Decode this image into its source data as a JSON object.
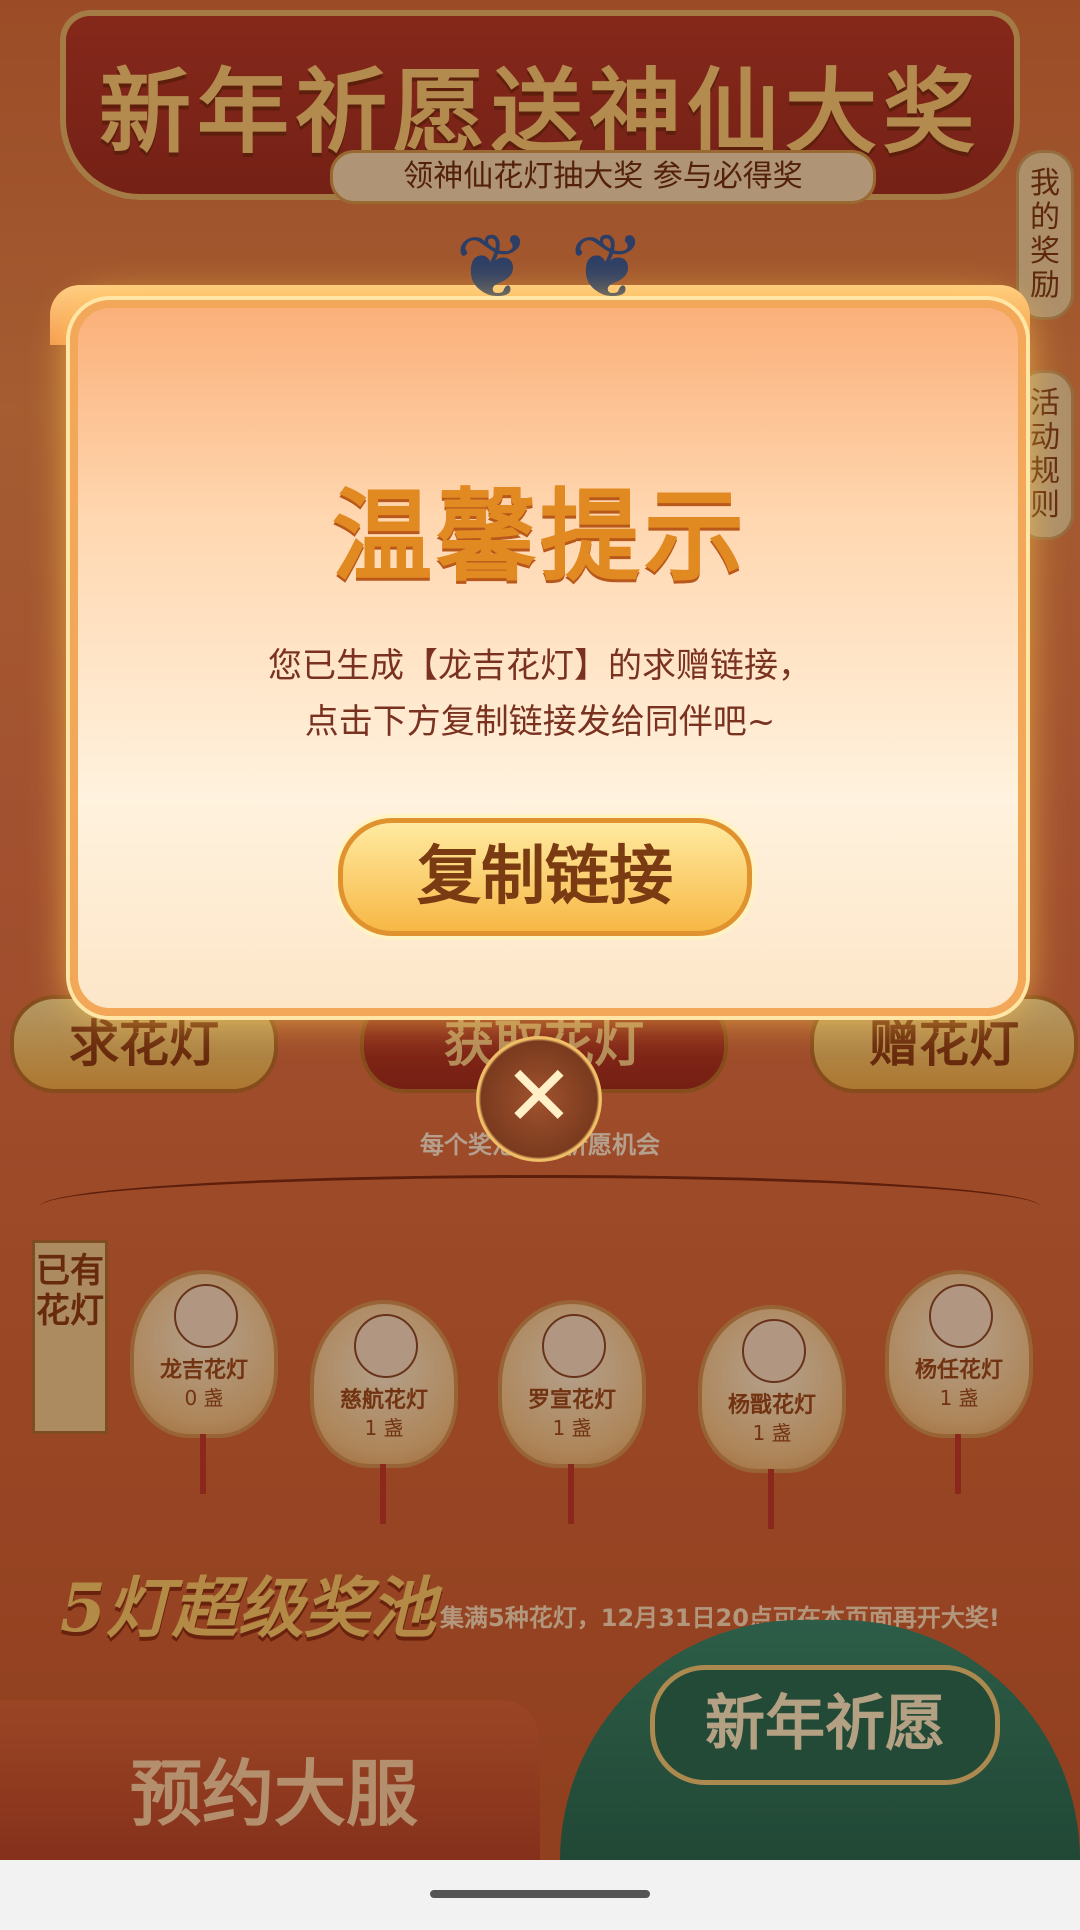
{
  "banner": {
    "title": "新年祈愿送神仙大奖",
    "subtitle": "领神仙花灯抽大奖 参与必得奖"
  },
  "side_tabs": {
    "rewards": "我的奖励",
    "rules": "活动规则"
  },
  "actions": {
    "request": "求花灯",
    "obtained": "获取花灯",
    "gift": "赠花灯",
    "caption": "每个奖池都有祈愿机会"
  },
  "lanterns": {
    "label": "已有花灯",
    "items": [
      {
        "name": "龙吉花灯",
        "count": "0 盏"
      },
      {
        "name": "慈航花灯",
        "count": "1 盏"
      },
      {
        "name": "罗宣花灯",
        "count": "1 盏"
      },
      {
        "name": "杨戬花灯",
        "count": "1 盏"
      },
      {
        "name": "杨任花灯",
        "count": "1 盏"
      }
    ]
  },
  "pool": {
    "title": "5灯超级奖池",
    "desc": "集满5种花灯，12月31日20点可在本页面再开大奖!"
  },
  "bottom": {
    "reserve": "预约大服",
    "wish": "新年祈愿"
  },
  "dialog": {
    "title": "温馨提示",
    "line1": "您已生成【龙吉花灯】的求赠链接，",
    "line2": "点击下方复制链接发给同伴吧~",
    "copy_button": "复制链接",
    "close_symbol": "✕"
  }
}
